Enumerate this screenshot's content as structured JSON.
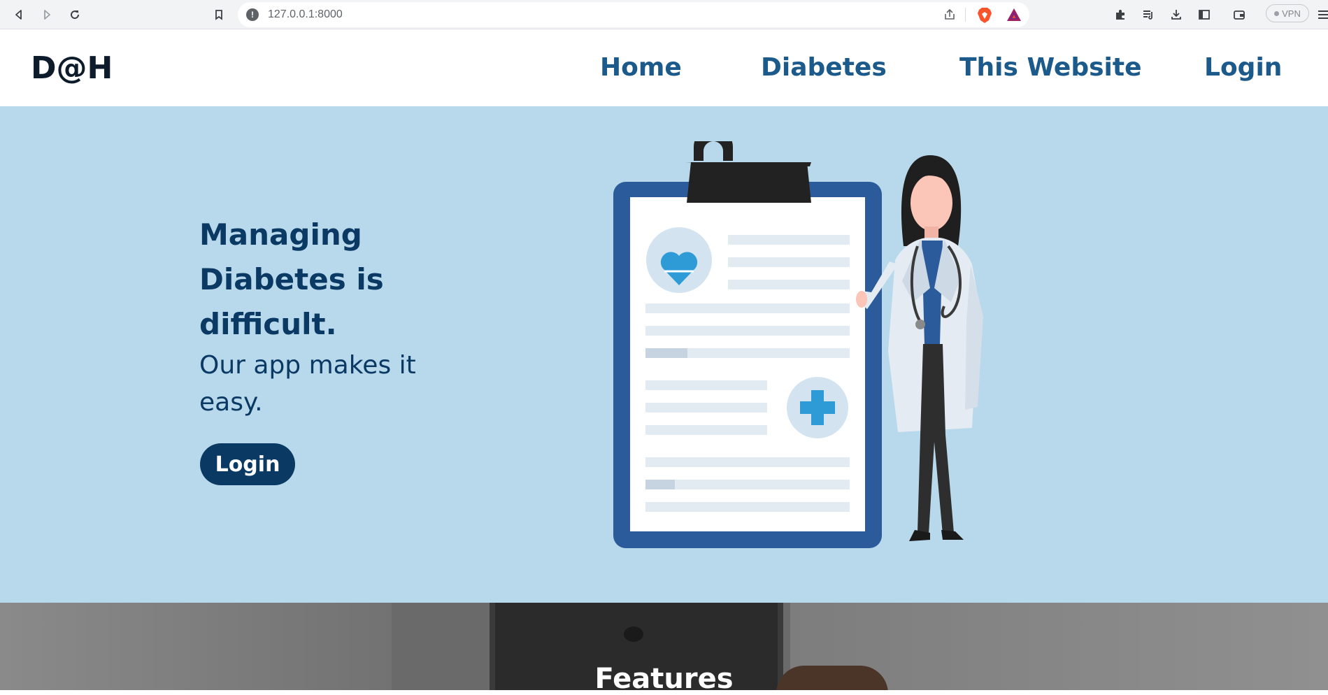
{
  "browser": {
    "url": "127.0.0.1:8000",
    "vpn_label": "VPN",
    "icons": [
      "back-icon",
      "forward-icon",
      "reload-icon",
      "bookmark-icon",
      "site-info-icon",
      "share-icon",
      "brave-shield-icon",
      "rewards-icon",
      "extensions-icon",
      "playlist-icon",
      "download-icon",
      "sidebar-icon",
      "wallet-icon",
      "menu-icon"
    ]
  },
  "header": {
    "brand": "D@H",
    "nav": [
      "Home",
      "Diabetes",
      "This Website",
      "Login"
    ]
  },
  "hero": {
    "headline": "Managing Diabetes is difficult.",
    "subline": "Our app makes it easy.",
    "button_label": "Login",
    "illustration": "doctor-with-clipboard-illustration"
  },
  "features": {
    "title": "Features"
  },
  "colors": {
    "hero_background": "#b8d9eb",
    "primary_dark": "#0a3963",
    "nav_link": "#1b5a8a",
    "clipboard_frame": "#2c5b9b",
    "accent_blue": "#2f9bd6"
  }
}
